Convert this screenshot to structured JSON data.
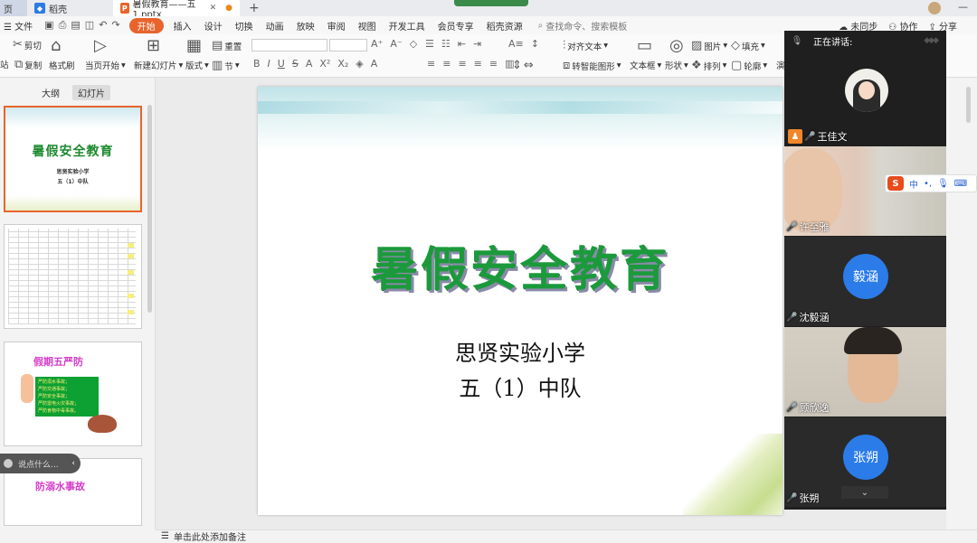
{
  "titlebar": {
    "home_tab": "页",
    "shell_tab": "稻壳",
    "doc_tab": "暑假教育——五1.pptx",
    "close_glyph": "✕",
    "new_tab_glyph": "+"
  },
  "menu": {
    "file": "文件",
    "items": [
      "开始",
      "插入",
      "设计",
      "切换",
      "动画",
      "放映",
      "审阅",
      "视图",
      "开发工具",
      "会员专享",
      "稻壳资源"
    ],
    "search_placeholder": "查找命令、搜索模板",
    "right": [
      "未同步",
      "协作",
      "分享"
    ]
  },
  "ribbon": {
    "cut": "剪切",
    "copy": "复制",
    "format_painter": "格式刷",
    "paste_prefix": "站",
    "play_from_current": "当页开始",
    "new_slide": "新建幻灯片",
    "layout": "版式",
    "reset": "重置",
    "section": "节",
    "align_text": "对齐文本",
    "convert_smartart": "转智能图形",
    "textbox": "文本框",
    "shape": "形状",
    "image": "图片",
    "fill": "填充",
    "arrange": "排列",
    "outline": "轮廓",
    "more": "演"
  },
  "left_panel": {
    "tab_outline": "大纲",
    "tab_slides": "幻灯片",
    "thumb1_title": "暑假安全教育",
    "thumb1_line1": "思贤实验小学",
    "thumb1_line2": "五（1）中队",
    "thumb3_title": "假期五严防",
    "thumb3_lines": [
      "严防溺水事故；",
      "严防交通事故；",
      "严防安全事故；",
      "严防雷电火灾事故；",
      "严防食物中毒事故。"
    ],
    "thumb4_title": "防溺水事故",
    "comment_prompt": "说点什么..."
  },
  "slide": {
    "title": "暑假安全教育",
    "subtitle_1": "思贤实验小学",
    "subtitle_2": "五（1）中队"
  },
  "notes": {
    "placeholder": "单击此处添加备注"
  },
  "meeting": {
    "speaking_label": "正在讲话:",
    "participants": [
      {
        "name": "王佳文",
        "role": "host"
      },
      {
        "name": "许至雅"
      },
      {
        "name": "沈毅涵",
        "initials": "毅涵"
      },
      {
        "name": "顾欣逸"
      },
      {
        "name": "张朔",
        "initials": "张朔"
      }
    ]
  },
  "ime": {
    "logo": "S",
    "mode": "中"
  },
  "colors": {
    "accent": "#e8642c",
    "slide_title": "#1b9a3b",
    "avatar_blue": "#2b7ce9"
  }
}
